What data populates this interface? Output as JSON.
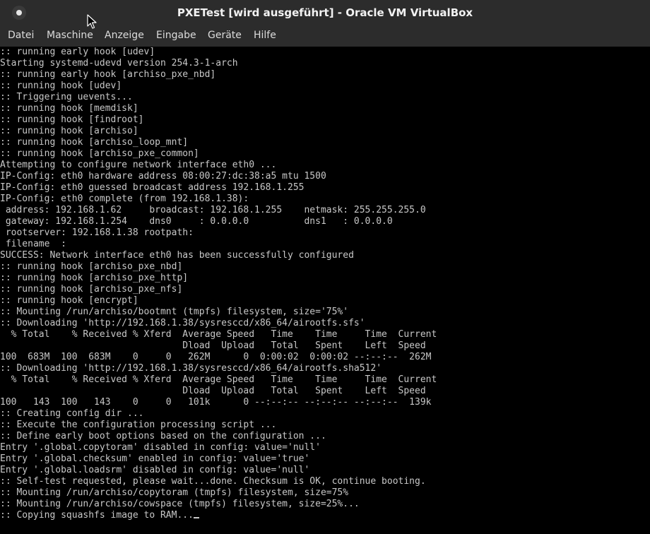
{
  "window": {
    "title": "PXETest [wird ausgeführt] - Oracle VM VirtualBox"
  },
  "menu": [
    "Datei",
    "Maschine",
    "Anzeige",
    "Eingabe",
    "Geräte",
    "Hilfe"
  ],
  "console": {
    "lines": [
      ":: running early hook [udev]",
      "Starting systemd-udevd version 254.3-1-arch",
      ":: running early hook [archiso_pxe_nbd]",
      ":: running hook [udev]",
      ":: Triggering uevents...",
      ":: running hook [memdisk]",
      ":: running hook [findroot]",
      ":: running hook [archiso]",
      ":: running hook [archiso_loop_mnt]",
      ":: running hook [archiso_pxe_common]",
      "Attempting to configure network interface eth0 ...",
      "IP-Config: eth0 hardware address 08:00:27:dc:38:a5 mtu 1500",
      "IP-Config: eth0 guessed broadcast address 192.168.1.255",
      "IP-Config: eth0 complete (from 192.168.1.38):",
      " address: 192.168.1.62     broadcast: 192.168.1.255    netmask: 255.255.255.0",
      " gateway: 192.168.1.254    dns0     : 0.0.0.0          dns1   : 0.0.0.0",
      " rootserver: 192.168.1.38 rootpath:",
      " filename  :",
      "SUCCESS: Network interface eth0 has been successfully configured",
      ":: running hook [archiso_pxe_nbd]",
      ":: running hook [archiso_pxe_http]",
      ":: running hook [archiso_pxe_nfs]",
      ":: running hook [encrypt]",
      ":: Mounting /run/archiso/bootmnt (tmpfs) filesystem, size='75%'",
      ":: Downloading 'http://192.168.1.38/sysresccd/x86_64/airootfs.sfs'",
      "  % Total    % Received % Xferd  Average Speed   Time    Time     Time  Current",
      "                                 Dload  Upload   Total   Spent    Left  Speed",
      "100  683M  100  683M    0     0   262M      0  0:00:02  0:00:02 --:--:--  262M",
      ":: Downloading 'http://192.168.1.38/sysresccd/x86_64/airootfs.sha512'",
      "  % Total    % Received % Xferd  Average Speed   Time    Time     Time  Current",
      "                                 Dload  Upload   Total   Spent    Left  Speed",
      "100   143  100   143    0     0   101k      0 --:--:-- --:--:-- --:--:--  139k",
      ":: Creating config dir ...",
      ":: Execute the configuration processing script ...",
      ":: Define early boot options based on the configuration ...",
      "Entry '.global.copytoram' disabled in config: value='null'",
      "Entry '.global.checksum' enabled in config: value='true'",
      "Entry '.global.loadsrm' disabled in config: value='null'",
      ":: Self-test requested, please wait...done. Checksum is OK, continue booting.",
      ":: Mounting /run/archiso/copytoram (tmpfs) filesystem, size=75%",
      ":: Mounting /run/archiso/cowspace (tmpfs) filesystem, size=25%...",
      ":: Copying squashfs image to RAM..."
    ]
  }
}
